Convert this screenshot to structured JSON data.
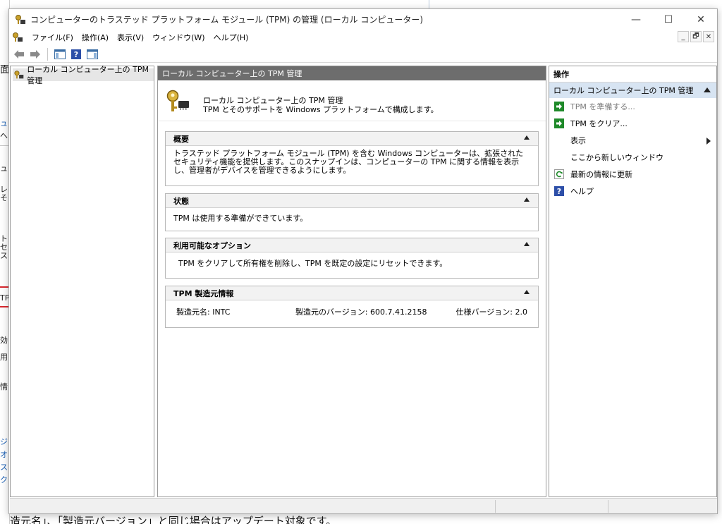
{
  "background": {
    "left_fragments": [
      "面",
      "ュ",
      "へ",
      "ュー",
      "レ",
      "その",
      "ト",
      "セ",
      "スを",
      "TPM",
      "効",
      "用",
      "情",
      "ジ",
      "オ",
      "ス",
      "ク"
    ],
    "bottom_text": "造元名」、「製造元バージョン」と同じ場合はアップデート対象です。"
  },
  "window": {
    "title": "コンピューターのトラステッド プラットフォーム モジュール (TPM) の管理 (ローカル コンピューター)",
    "controls": {
      "minimize": "—",
      "maximize": "☐",
      "close": "✕"
    }
  },
  "menu": {
    "items": [
      "ファイル(F)",
      "操作(A)",
      "表示(V)",
      "ウィンドウ(W)",
      "ヘルプ(H)"
    ],
    "mdi_controls": {
      "minimize": "_",
      "restore": "🗗",
      "close": "✕"
    }
  },
  "tree": {
    "root_label": "ローカル コンピューター上の TPM 管理"
  },
  "center": {
    "header": "ローカル コンピューター上の TPM 管理",
    "intro_line1": "ローカル コンピューター上の TPM 管理",
    "intro_line2": "TPM とそのサポートを Windows プラットフォームで構成します。",
    "panels": {
      "overview": {
        "title": "概要",
        "body": "トラステッド プラットフォーム モジュール (TPM) を含む Windows コンピューターは、拡張されたセキュリティ機能を提供します。このスナップインは、コンピューターの TPM に関する情報を表示し、管理者がデバイスを管理できるようにします。"
      },
      "status": {
        "title": "状態",
        "body": "TPM は使用する準備ができています。"
      },
      "options": {
        "title": "利用可能なオプション",
        "body": "TPM をクリアして所有権を削除し、TPM を既定の設定にリセットできます。"
      },
      "manufacturer": {
        "title": "TPM 製造元情報",
        "name": "製造元名: INTC",
        "version": "製造元のバージョン: 600.7.41.2158",
        "spec": "仕様バージョン: 2.0"
      }
    }
  },
  "actions": {
    "header": "操作",
    "section": "ローカル コンピューター上の TPM 管理",
    "items": {
      "prepare": "TPM を準備する...",
      "clear": "TPM をクリア...",
      "view": "表示",
      "new_window": "ここから新しいウィンドウ",
      "refresh": "最新の情報に更新",
      "help": "ヘルプ"
    }
  },
  "colors": {
    "center_header": "#6d6d6d",
    "action_section": "#d7e4f2",
    "action_icon_green": "#1f8a2a",
    "help_icon_blue": "#2d4fa8"
  }
}
